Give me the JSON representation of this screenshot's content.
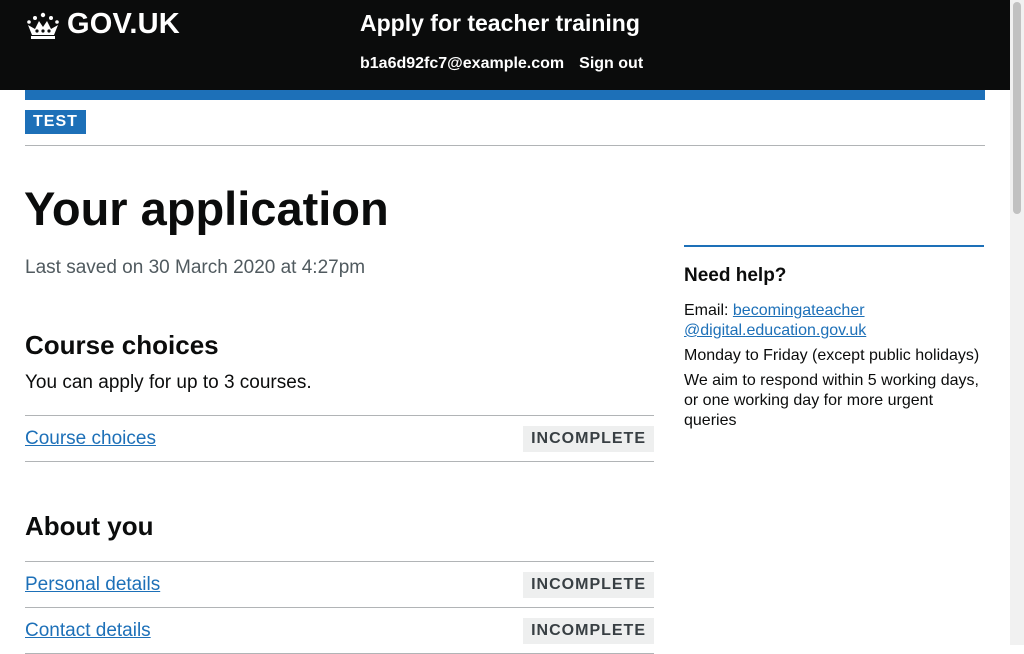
{
  "header": {
    "logo_text": "GOV.UK",
    "service_name": "Apply for teacher training",
    "user_email": "b1a6d92fc7@example.com",
    "sign_out": "Sign out"
  },
  "phase": {
    "tag": "TEST"
  },
  "main": {
    "title": "Your application",
    "last_saved": "Last saved on 30 March 2020 at 4:27pm",
    "sections": [
      {
        "heading": "Course choices",
        "description": "You can apply for up to 3 courses.",
        "tasks": [
          {
            "label": "Course choices",
            "status": "INCOMPLETE"
          }
        ]
      },
      {
        "heading": "About you",
        "tasks": [
          {
            "label": "Personal details",
            "status": "INCOMPLETE"
          },
          {
            "label": "Contact details",
            "status": "INCOMPLETE"
          }
        ]
      }
    ]
  },
  "sidebar": {
    "heading": "Need help?",
    "email_label": "Email: ",
    "email_line1": "becomingateacher",
    "email_line2": "@digital.education.gov.uk",
    "hours": "Monday to Friday (except public holidays)",
    "response": "We aim to respond within 5 working days, or one working day for more urgent queries"
  },
  "colors": {
    "header_bg": "#0b0c0c",
    "brand_blue": "#1d70b8",
    "link": "#1d70b8",
    "tag_grey": "#eeefef"
  }
}
